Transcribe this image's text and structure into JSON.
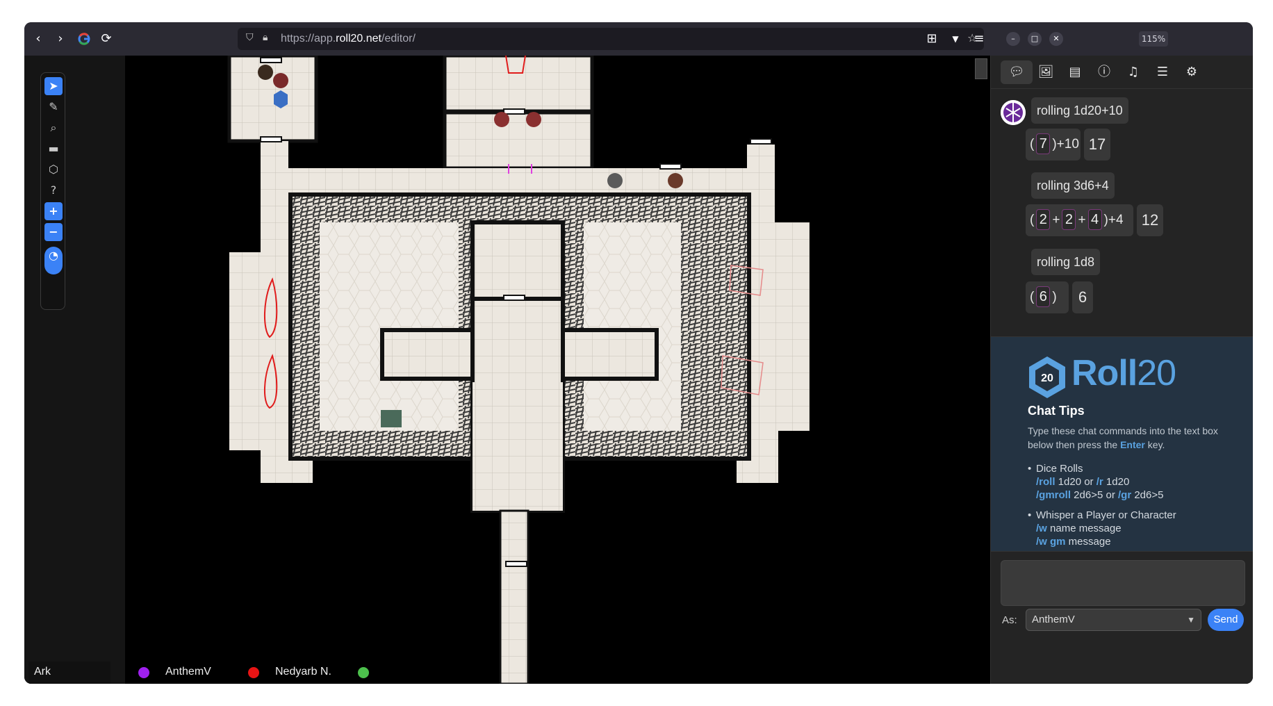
{
  "browser": {
    "url_prefix": "https://app.",
    "url_domain": "roll20.net",
    "url_path": "/editor/",
    "zoom": "115%"
  },
  "tools": [
    {
      "name": "select",
      "icon": "cursor-icon"
    },
    {
      "name": "draw",
      "icon": "brush-icon"
    },
    {
      "name": "zoom",
      "icon": "magnify-icon"
    },
    {
      "name": "measure",
      "icon": "ruler-icon"
    },
    {
      "name": "dice",
      "icon": "d20-icon"
    },
    {
      "name": "help",
      "icon": "question-icon"
    },
    {
      "name": "zoom-in",
      "label": "+"
    },
    {
      "name": "zoom-out",
      "label": "−"
    }
  ],
  "players": [
    {
      "name": "Ark",
      "color": ""
    },
    {
      "name": "AnthemV",
      "color": "#a020f0"
    },
    {
      "name": "Nedyarb N.",
      "color": "#e81414"
    },
    {
      "name": "",
      "color": "#4cc04c"
    }
  ],
  "chat": {
    "rolls": [
      {
        "label": "rolling 1d20+10",
        "open": "(",
        "dice": [
          "7"
        ],
        "modifier": ")+10",
        "total": "17"
      },
      {
        "label": "rolling 3d6+4",
        "open": "(",
        "dice": [
          "2",
          "2",
          "4"
        ],
        "modifier": ")+4",
        "total": "12"
      },
      {
        "label": "rolling 1d8",
        "open": "(",
        "dice": [
          "6"
        ],
        "modifier": ")",
        "total": "6"
      }
    ],
    "plus": "+"
  },
  "tips": {
    "logo_bold": "Roll",
    "logo_thin": "20",
    "badge": "20",
    "title": "Chat Tips",
    "intro_1": "Type these chat commands into the text box below then press the ",
    "intro_key": "Enter",
    "intro_2": " key.",
    "dice_heading": "Dice Rolls",
    "roll_cmd": "/roll",
    "roll_arg": " 1d20 or ",
    "r_cmd": "/r",
    "r_arg": " 1d20",
    "gmroll_cmd": "/gmroll",
    "gmroll_arg": " 2d6>5 or ",
    "gr_cmd": "/gr",
    "gr_arg": " 2d6>5",
    "whisper_heading": "Whisper a Player or Character",
    "w_cmd": "/w",
    "w_arg": " name message",
    "wgm_cmd": "/w gm",
    "wgm_arg": " message"
  },
  "chat_form": {
    "as_label": "As:",
    "as_value": "AnthemV",
    "send_label": "Send"
  }
}
